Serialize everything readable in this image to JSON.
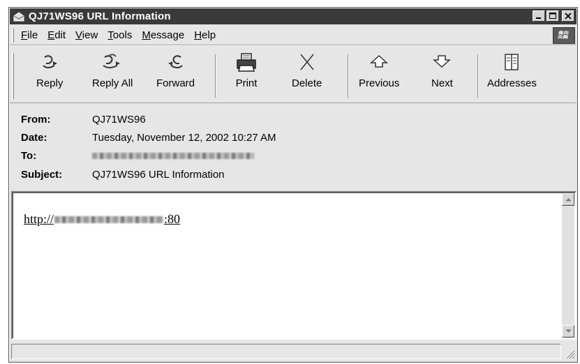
{
  "window": {
    "title": "QJ71WS96 URL Information",
    "icon": "mail-envelope-icon"
  },
  "menu": {
    "items": [
      {
        "pre": "",
        "ul": "F",
        "post": "ile"
      },
      {
        "pre": "",
        "ul": "E",
        "post": "dit"
      },
      {
        "pre": "",
        "ul": "V",
        "post": "iew"
      },
      {
        "pre": "",
        "ul": "T",
        "post": "ools"
      },
      {
        "pre": "",
        "ul": "M",
        "post": "essage"
      },
      {
        "pre": "",
        "ul": "H",
        "post": "elp"
      }
    ]
  },
  "toolbar": {
    "reply": "Reply",
    "reply_all": "Reply All",
    "forward": "Forward",
    "print": "Print",
    "delete": "Delete",
    "previous": "Previous",
    "next": "Next",
    "addresses": "Addresses"
  },
  "header": {
    "from_label": "From:",
    "from_value": "QJ71WS96",
    "date_label": "Date:",
    "date_value": "Tuesday, November 12, 2002 10:27 AM",
    "to_label": "To:",
    "to_value": "",
    "subject_label": "Subject:",
    "subject_value": "QJ71WS96 URL Information"
  },
  "message": {
    "url_prefix": "http://",
    "url_suffix": ":80"
  },
  "colors": {
    "titlebar": "#3a3a3a",
    "chrome": "#e6e6e6"
  }
}
